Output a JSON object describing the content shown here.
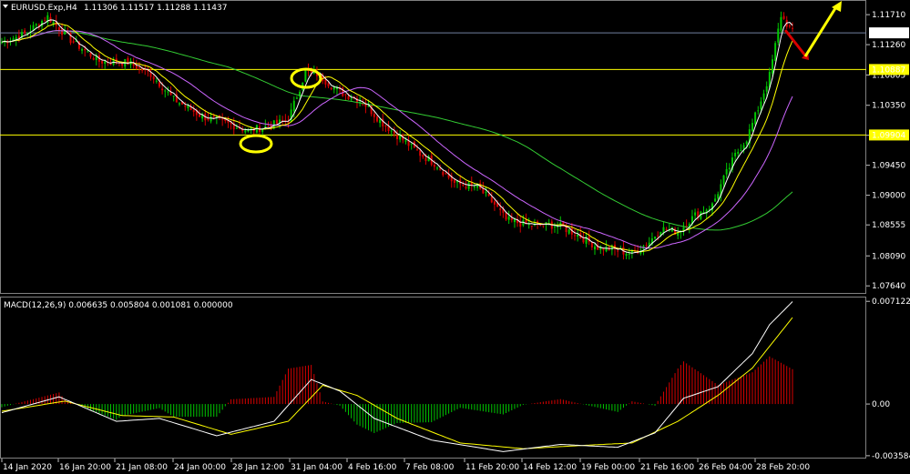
{
  "window": {
    "title": "EURUSD.Exp,H4",
    "ohlc": "1.11306 1.11517 1.11288 1.11437"
  },
  "colors": {
    "background": "#000000",
    "bull": "#00c800",
    "bear": "#d80000",
    "ma_fast": "#ffffff",
    "ma_mid": "#ffff00",
    "ma_slow": "#cc66ff",
    "ma_long": "#33cc33",
    "level_lines": "#ffff00",
    "annotation": "#ffff00",
    "macd_line": "#ffffff",
    "signal_line": "#ffff00"
  },
  "chart_data": [
    {
      "type": "candlestick",
      "symbol": "EURUSD.Exp",
      "timeframe": "H4",
      "ylim": [
        1.0752,
        1.1193
      ],
      "yticks": [
        "1.11710",
        "1.11260",
        "1.10805",
        "1.10350",
        "1.09900",
        "1.09450",
        "1.09000",
        "1.08555",
        "1.08090",
        "1.07640"
      ],
      "x_labels": [
        "14 Jan 2020",
        "16 Jan 20:00",
        "21 Jan 08:00",
        "24 Jan 00:00",
        "28 Jan 12:00",
        "31 Jan 04:00",
        "4 Feb 16:00",
        "7 Feb 08:00",
        "11 Feb 20:00",
        "14 Feb 12:00",
        "19 Feb 00:00",
        "21 Feb 16:00",
        "26 Feb 04:00",
        "28 Feb 20:00"
      ],
      "current_price": "1.11437",
      "level_labels": [
        "1.10887",
        "1.09904"
      ],
      "price_path": [
        [
          0,
          1.113
        ],
        [
          8,
          1.1142
        ],
        [
          16,
          1.1168
        ],
        [
          24,
          1.1133
        ],
        [
          34,
          1.1101
        ],
        [
          44,
          1.1099
        ],
        [
          52,
          1.1082
        ],
        [
          60,
          1.1044
        ],
        [
          70,
          1.1018
        ],
        [
          80,
          1.1006
        ],
        [
          86,
          1.0997
        ],
        [
          94,
          1.1005
        ],
        [
          100,
          1.1013
        ],
        [
          106,
          1.1085
        ],
        [
          110,
          1.1082
        ],
        [
          118,
          1.1055
        ],
        [
          126,
          1.104
        ],
        [
          132,
          1.1012
        ],
        [
          138,
          1.099
        ],
        [
          146,
          1.0962
        ],
        [
          152,
          1.0945
        ],
        [
          158,
          1.0918
        ],
        [
          166,
          1.0912
        ],
        [
          172,
          1.0886
        ],
        [
          176,
          1.0863
        ],
        [
          184,
          1.0855
        ],
        [
          194,
          1.0855
        ],
        [
          200,
          1.0843
        ],
        [
          208,
          1.0822
        ],
        [
          214,
          1.0818
        ],
        [
          220,
          1.0812
        ],
        [
          226,
          1.083
        ],
        [
          230,
          1.085
        ],
        [
          236,
          1.0845
        ],
        [
          242,
          1.087
        ],
        [
          248,
          1.0885
        ],
        [
          252,
          1.0925
        ],
        [
          256,
          1.096
        ],
        [
          260,
          1.0985
        ],
        [
          264,
          1.103
        ],
        [
          268,
          1.108
        ],
        [
          272,
          1.117
        ],
        [
          276,
          1.1144
        ]
      ],
      "macd": {
        "label": "MACD(12,26,9) 0.006635 0.005804 0.001081 0.000000",
        "ylim": [
          -0.00378,
          0.00745
        ],
        "yticks": [
          "0.007122",
          "0.00",
          "-0.003584"
        ],
        "macd_path": [
          [
            0,
            -0.0006
          ],
          [
            20,
            0.0005
          ],
          [
            40,
            -0.0012
          ],
          [
            55,
            -0.001
          ],
          [
            75,
            -0.0022
          ],
          [
            95,
            -0.0012
          ],
          [
            108,
            0.0017
          ],
          [
            118,
            0.0009
          ],
          [
            130,
            -0.001
          ],
          [
            150,
            -0.0025
          ],
          [
            175,
            -0.0033
          ],
          [
            195,
            -0.0028
          ],
          [
            215,
            -0.003
          ],
          [
            228,
            -0.002
          ],
          [
            238,
            0.0004
          ],
          [
            250,
            0.0012
          ],
          [
            262,
            0.0035
          ],
          [
            268,
            0.0055
          ],
          [
            276,
            0.0071
          ]
        ],
        "signal_path": [
          [
            0,
            -0.0005
          ],
          [
            22,
            0.0002
          ],
          [
            42,
            -0.0008
          ],
          [
            60,
            -0.0009
          ],
          [
            80,
            -0.0021
          ],
          [
            100,
            -0.0012
          ],
          [
            112,
            0.0013
          ],
          [
            124,
            0.0006
          ],
          [
            138,
            -0.001
          ],
          [
            160,
            -0.0027
          ],
          [
            182,
            -0.0031
          ],
          [
            200,
            -0.0029
          ],
          [
            220,
            -0.0027
          ],
          [
            236,
            -0.0012
          ],
          [
            250,
            0.0006
          ],
          [
            262,
            0.0025
          ],
          [
            270,
            0.0045
          ],
          [
            276,
            0.006
          ]
        ]
      }
    }
  ]
}
